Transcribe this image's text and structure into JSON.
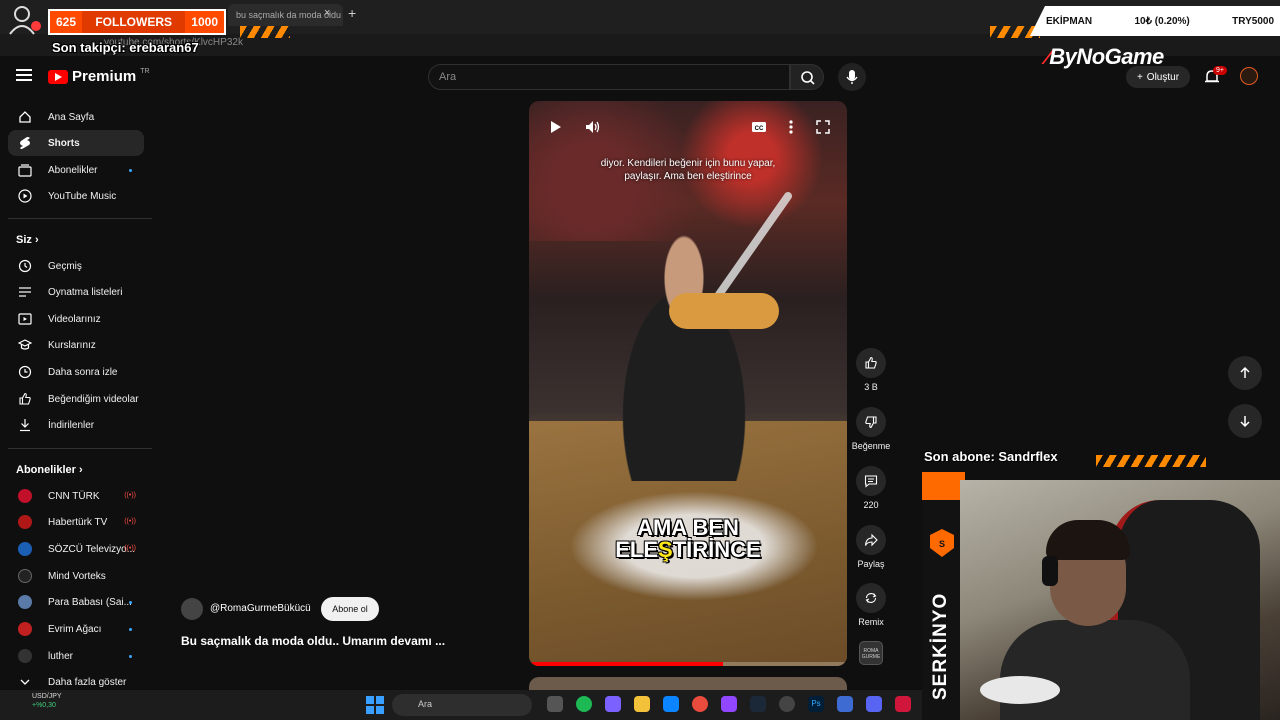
{
  "browser": {
    "tab_title": "bu saçmalık da moda oldu",
    "tab_close": "×",
    "new_tab": "+",
    "url": "youtube.com/shorts/KlvcHP32k"
  },
  "stream_overlay": {
    "followers_current": "625",
    "followers_label": "FOLLOWERS",
    "followers_goal": "1000",
    "last_follower": "Son takipçi: erebaran67",
    "ticker_left": "EKİPMAN",
    "ticker_mid": "10₺ (0.20%)",
    "ticker_right": "TRY5000",
    "brand": "ByNoGame",
    "last_sub": "Son abone: Sandrflex",
    "streamer_name": "SERKİNYO"
  },
  "header": {
    "logo_text": "Premium",
    "logo_region": "TR",
    "search_placeholder": "Ara",
    "create_label": "Oluştur",
    "notifications_badge": "9+"
  },
  "sidebar": {
    "main": [
      {
        "label": "Ana Sayfa",
        "icon": "home-icon"
      },
      {
        "label": "Shorts",
        "icon": "shorts-icon",
        "active": true
      },
      {
        "label": "Abonelikler",
        "icon": "subscriptions-icon",
        "dot": true
      },
      {
        "label": "YouTube Music",
        "icon": "music-icon"
      }
    ],
    "you_header": "Siz",
    "you": [
      {
        "label": "Geçmiş",
        "icon": "history-icon"
      },
      {
        "label": "Oynatma listeleri",
        "icon": "playlist-icon"
      },
      {
        "label": "Videolarınız",
        "icon": "your-videos-icon"
      },
      {
        "label": "Kurslarınız",
        "icon": "courses-icon"
      },
      {
        "label": "Daha sonra izle",
        "icon": "watch-later-icon"
      },
      {
        "label": "Beğendiğim videolar",
        "icon": "liked-icon"
      },
      {
        "label": "İndirilenler",
        "icon": "download-icon"
      }
    ],
    "subs_header": "Abonelikler",
    "subs": [
      {
        "label": "CNN TÜRK",
        "color": "#c0102a",
        "live": true
      },
      {
        "label": "Habertürk TV",
        "color": "#b01818",
        "live": true
      },
      {
        "label": "SÖZCÜ Televizyo...",
        "color": "#1a5fb4",
        "live": true
      },
      {
        "label": "Mind Vorteks",
        "color": "#222222"
      },
      {
        "label": "Para Babası (Sai...",
        "color": "#5a7aa8",
        "dot": true
      },
      {
        "label": "Evrim Ağacı",
        "color": "#c02020",
        "dot": true
      },
      {
        "label": "luther",
        "color": "#333333",
        "dot": true
      }
    ],
    "show_more": "Daha fazla göster"
  },
  "short": {
    "caption_top": "diyor. Kendileri beğenir için bunu yapar, paylaşır. Ama ben eleştirince",
    "caption_big_line1": "AMA BEN",
    "caption_big_line2_a": "ELE",
    "caption_big_line2_b": "Ş",
    "caption_big_line2_c": "TİRİNCE",
    "progress": 0.61,
    "channel": "@RomaGurmeBükücü",
    "subscribe": "Abone ol",
    "title": "Bu saçmalık da moda oldu.. Umarım devamı ...",
    "likes": "3 B",
    "dislike_label": "Beğenme",
    "comments": "220",
    "share_label": "Paylaş",
    "remix_label": "Remix",
    "sound_thumb_text": "ROMA GURME"
  },
  "taskbar": {
    "ticker_pair": "USD/JPY",
    "ticker_change": "+%0,30",
    "search_placeholder": "Ara"
  },
  "colors": {
    "accent_orange": "#ff6a00",
    "yt_red": "#ff0000",
    "brand_red": "#ff2a2a"
  }
}
